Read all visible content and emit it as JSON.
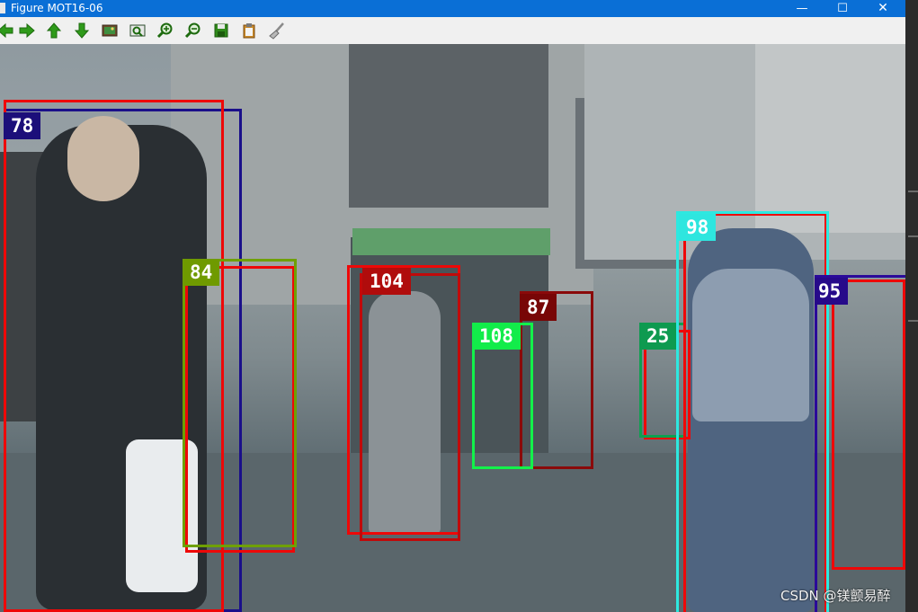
{
  "window": {
    "title": "Figure MOT16-06",
    "minimize": "—",
    "maximize": "☐",
    "close": "✕"
  },
  "toolbar": {
    "buttons": [
      {
        "name": "back-button",
        "icon": "arrow-left-icon"
      },
      {
        "name": "forward-button",
        "icon": "arrow-right-icon"
      },
      {
        "name": "pan-up-button",
        "icon": "arrow-up-icon"
      },
      {
        "name": "pan-down-button",
        "icon": "arrow-down-icon"
      },
      {
        "name": "image-button",
        "icon": "image-icon"
      },
      {
        "name": "fit-button",
        "icon": "fit-view-icon"
      },
      {
        "name": "zoom-in-button",
        "icon": "zoom-in-icon"
      },
      {
        "name": "zoom-out-button",
        "icon": "zoom-out-icon"
      },
      {
        "name": "save-button",
        "icon": "floppy-save-icon"
      },
      {
        "name": "clipboard-button",
        "icon": "clipboard-icon"
      },
      {
        "name": "clear-button",
        "icon": "brush-icon"
      }
    ]
  },
  "detections": [
    {
      "id": "78",
      "box_color": "#1a0f8a",
      "label_bg": "#1c0f7a"
    },
    {
      "id": "84",
      "box_color": "#6fa000",
      "label_bg": "#6f9a00"
    },
    {
      "id": "104",
      "box_color": "#ee0808",
      "label_bg": "#b00c0c"
    },
    {
      "id": "87",
      "box_color": "#8a0a0a",
      "label_bg": "#780606"
    },
    {
      "id": "108",
      "box_color": "#12f24a",
      "label_bg": "#12ec4a"
    },
    {
      "id": "25",
      "box_color": "#0ea050",
      "label_bg": "#0e9a50"
    },
    {
      "id": "98",
      "box_color": "#2ee8e0",
      "label_bg": "#2ee6df"
    },
    {
      "id": "95",
      "box_color": "#2a0a9a",
      "label_bg": "#260a8a"
    }
  ],
  "watermark": "CSDN @镁颤易醉"
}
